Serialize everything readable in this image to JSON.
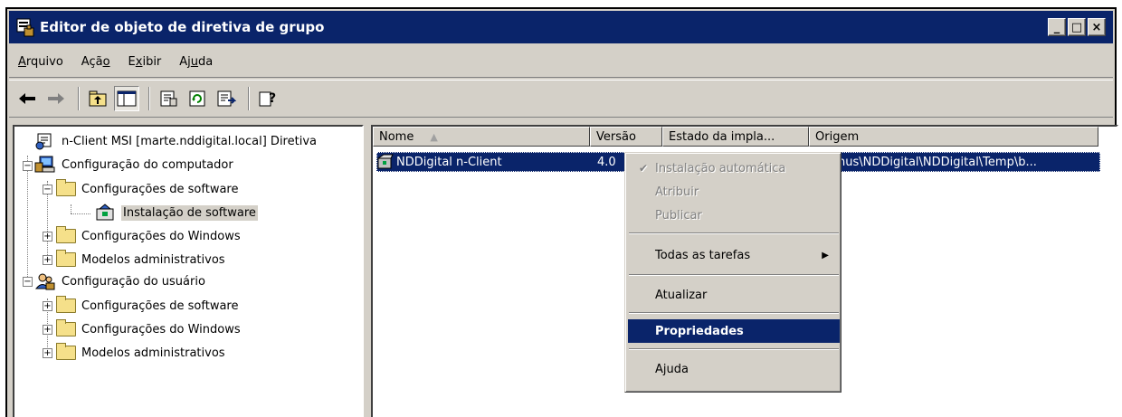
{
  "window": {
    "title": "Editor de objeto de diretiva de grupo",
    "controls": {
      "minimize": "_",
      "maximize": "□",
      "close": "×"
    }
  },
  "menubar": {
    "items": [
      {
        "label": "Arquivo",
        "accel": "A"
      },
      {
        "label": "Ação",
        "accel": "o"
      },
      {
        "label": "Exibir",
        "accel": "x"
      },
      {
        "label": "Ajuda",
        "accel": "u"
      }
    ]
  },
  "toolbar": {
    "buttons": [
      "back-icon",
      "forward-icon",
      "up-folder-icon",
      "show-hide-tree-icon",
      "properties-icon",
      "refresh-icon",
      "export-list-icon",
      "help-icon"
    ]
  },
  "tree": {
    "root": "n-Client MSI [marte.nddigital.local] Diretiva",
    "computer_config": "Configuração do computador",
    "software_settings_1": "Configurações de software",
    "software_installation": "Instalação de software",
    "windows_settings_1": "Configurações do Windows",
    "admin_templates_1": "Modelos administrativos",
    "user_config": "Configuração do usuário",
    "software_settings_2": "Configurações de software",
    "windows_settings_2": "Configurações do Windows",
    "admin_templates_2": "Modelos administrativos"
  },
  "list": {
    "columns": [
      "Nome",
      "Versão",
      "Estado da impla...",
      "Origem"
    ],
    "rows": [
      {
        "name": "NDDigital n-Client",
        "version": "4.0",
        "state": "",
        "origin": "nus\\NDDigital\\NDDigital\\Temp\\b..."
      }
    ]
  },
  "context_menu": {
    "auto_install": "Instalação automática",
    "assign": "Atribuir",
    "publish": "Publicar",
    "all_tasks": "Todas as tarefas",
    "refresh": "Atualizar",
    "properties": "Propriedades",
    "help": "Ajuda"
  },
  "colors": {
    "titlebar": "#0a246a",
    "face": "#d4d0c8",
    "selection": "#0a246a"
  }
}
